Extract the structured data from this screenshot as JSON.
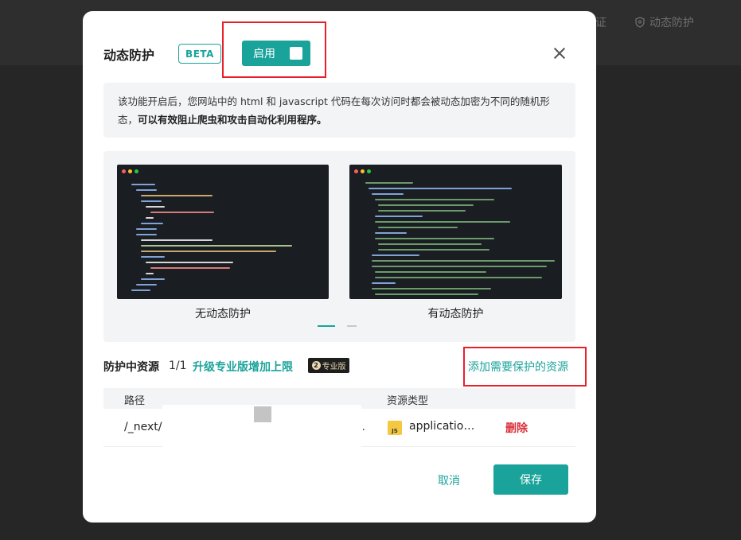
{
  "background": {
    "nav_partial": "证",
    "nav_item": "动态防护"
  },
  "modal": {
    "title": "动态防护",
    "beta_badge": "BETA",
    "enable_label": "启用",
    "description_normal": "该功能开启后，您网站中的 html 和 javascript 代码在每次访问时都会被动态加密为不同的随机形态，",
    "description_bold": "可以有效阻止爬虫和攻击自动化利用程序。",
    "carousel": {
      "left_caption": "无动态防护",
      "right_caption": "有动态防护"
    },
    "resources": {
      "title": "防护中资源",
      "count": "1/1",
      "upgrade_link": "升级专业版增加上限",
      "pro_badge": "专业版",
      "add_link": "添加需要保护的资源"
    },
    "table": {
      "col_path": "路径",
      "col_type": "资源类型",
      "rows": [
        {
          "path": "/_next/",
          "path_ellipsis": "..",
          "type": "applicatio…",
          "delete": "删除"
        }
      ]
    },
    "cancel_label": "取消",
    "save_label": "保存"
  },
  "colors": {
    "accent": "#1aa39a",
    "highlight": "#e8202a",
    "danger": "#d9303a"
  }
}
